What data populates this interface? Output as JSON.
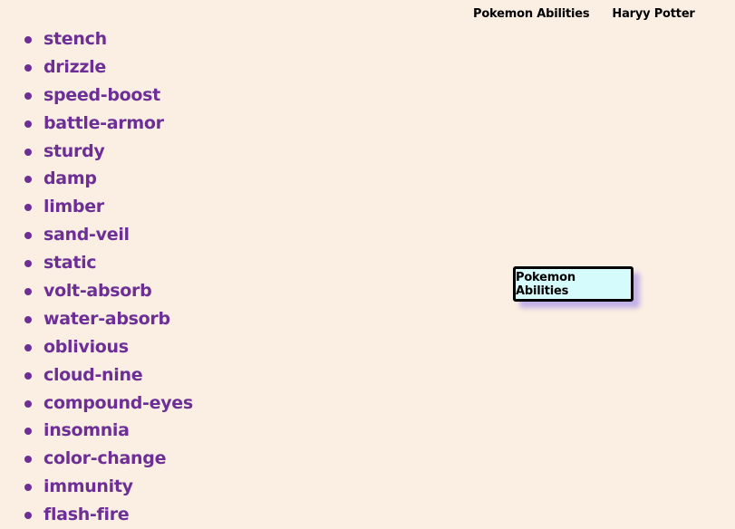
{
  "nav": {
    "links": [
      {
        "label": "Pokemon Abilities"
      },
      {
        "label": "Haryy Potter"
      }
    ]
  },
  "abilities": [
    "stench",
    "drizzle",
    "speed-boost",
    "battle-armor",
    "sturdy",
    "damp",
    "limber",
    "sand-veil",
    "static",
    "volt-absorb",
    "water-absorb",
    "oblivious",
    "cloud-nine",
    "compound-eyes",
    "insomnia",
    "color-change",
    "immunity",
    "flash-fire"
  ],
  "card": {
    "label": "Pokemon Abilities"
  },
  "colors": {
    "background": "#fbefe3",
    "list_text": "#6d2f96",
    "card_bg": "#d6fbfd",
    "card_shadow": "#c2b0e6"
  }
}
